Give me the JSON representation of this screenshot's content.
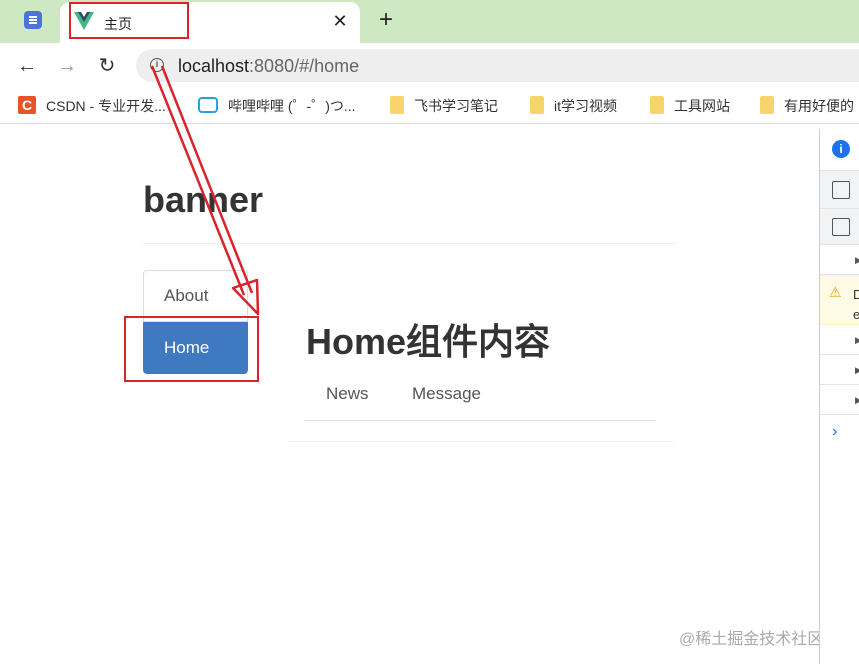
{
  "browser": {
    "tab": {
      "title": "主页",
      "favicon": "vue-logo-icon",
      "close_glyph": "✕"
    },
    "new_tab_glyph": "+",
    "nav": {
      "back_glyph": "←",
      "forward_glyph": "→",
      "reload_glyph": "↻"
    },
    "address": {
      "host": "localhost",
      "rest": ":8080/#/home",
      "info_glyph": "i"
    },
    "bookmarks": [
      {
        "label": "CSDN - 专业开发...",
        "icon": "csdn-icon"
      },
      {
        "label": "哔哩哔哩 (゜-゜)つ...",
        "icon": "bilibili-icon"
      },
      {
        "label": "飞书学习笔记",
        "icon": "folder-icon"
      },
      {
        "label": "it学习视频",
        "icon": "folder-icon"
      },
      {
        "label": "工具网站",
        "icon": "folder-icon"
      },
      {
        "label": "有用好便的",
        "icon": "folder-icon"
      }
    ],
    "colors": {
      "tabstrip": "#cfe8c4",
      "active_nav": "#3f7ac0",
      "annotation": "#d9232d"
    }
  },
  "page": {
    "banner": "banner",
    "nav_items": [
      {
        "label": "About",
        "active": false
      },
      {
        "label": "Home",
        "active": true
      }
    ],
    "home_title": "Home组件内容",
    "subtabs": [
      "News",
      "Message"
    ],
    "watermark": "@稀土掘金技术社区"
  },
  "devtools": {
    "info_glyph": "i",
    "warning_glyph": "⚠",
    "warning_text": "D\ne",
    "expand_glyph": "›"
  }
}
